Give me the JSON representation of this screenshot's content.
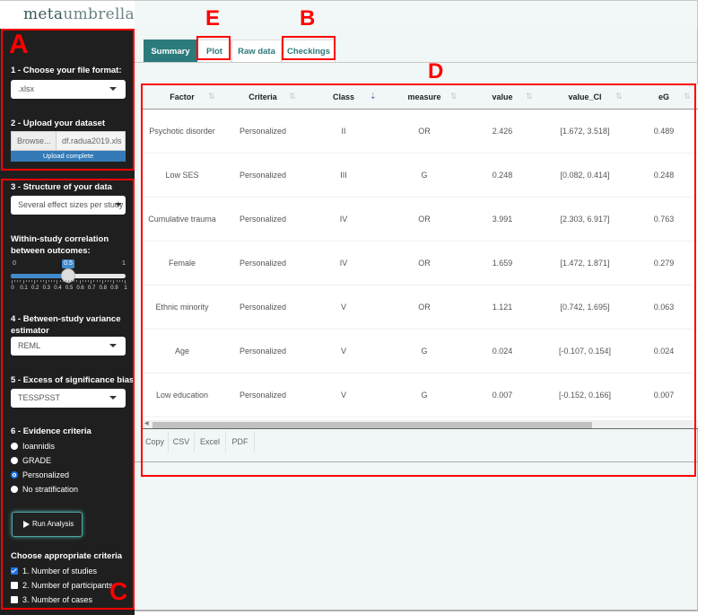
{
  "app": {
    "brand_strong": "meta",
    "brand_light": "umbrella"
  },
  "annotations": {
    "A": "A",
    "B": "B",
    "C": "C",
    "D": "D",
    "E": "E"
  },
  "sidebar": {
    "file_format_label": "1 - Choose your file format:",
    "file_format_value": ".xlsx",
    "upload_label": "2 - Upload your dataset",
    "browse_label": "Browse...",
    "file_name": "df.radua2019.xls",
    "upload_status": "Upload complete",
    "structure_label": "3 - Structure of your data",
    "structure_value": "Several effect sizes per study",
    "correlation_label_1": "Within-study correlation",
    "correlation_label_2": "between outcomes:",
    "slider": {
      "min": "0",
      "max": "1",
      "value": "0.5",
      "fraction": 0.5,
      "tick_labels": [
        "0",
        "0.1",
        "0.2",
        "0.3",
        "0.4",
        "0.5",
        "0.6",
        "0.7",
        "0.8",
        "0.9",
        "1"
      ]
    },
    "variance_label_1": "4 - Between-study variance",
    "variance_label_2": "estimator",
    "variance_value": "REML",
    "bias_label": "5 - Excess of significance bias",
    "bias_value": "TESSPSST",
    "evidence_label": "6 - Evidence criteria",
    "evidence_options": [
      {
        "label": "Ioannidis",
        "checked": false
      },
      {
        "label": "GRADE",
        "checked": false
      },
      {
        "label": "Personalized",
        "checked": true
      },
      {
        "label": "No stratification",
        "checked": false
      }
    ],
    "run_label": "Run Analysis",
    "criteria_label": "Choose appropriate criteria",
    "criteria_options": [
      {
        "label": "1. Number of studies",
        "checked": true
      },
      {
        "label": "2. Number of participants",
        "checked": false
      },
      {
        "label": "3. Number of cases",
        "checked": false
      }
    ]
  },
  "tabs": [
    {
      "label": "Summary",
      "active": true
    },
    {
      "label": "Plot",
      "active": false
    },
    {
      "label": "Raw data",
      "active": false
    },
    {
      "label": "Checkings",
      "active": false
    }
  ],
  "table": {
    "columns": [
      "Factor",
      "Criteria",
      "Class",
      "measure",
      "value",
      "value_CI",
      "eG"
    ],
    "sorted_column": "Class",
    "rows": [
      [
        "Psychotic disorder",
        "Personalized",
        "II",
        "OR",
        "2.426",
        "[1.672, 3.518]",
        "0.489"
      ],
      [
        "Low SES",
        "Personalized",
        "III",
        "G",
        "0.248",
        "[0.082, 0.414]",
        "0.248"
      ],
      [
        "Cumulative trauma",
        "Personalized",
        "IV",
        "OR",
        "3.991",
        "[2.303, 6.917]",
        "0.763"
      ],
      [
        "Female",
        "Personalized",
        "IV",
        "OR",
        "1.659",
        "[1.472, 1.871]",
        "0.279"
      ],
      [
        "Ethnic minority",
        "Personalized",
        "V",
        "OR",
        "1.121",
        "[0.742, 1.695]",
        "0.063"
      ],
      [
        "Age",
        "Personalized",
        "V",
        "G",
        "0.024",
        "[-0.107, 0.154]",
        "0.024"
      ],
      [
        "Low education",
        "Personalized",
        "V",
        "G",
        "0.007",
        "[-0.152, 0.166]",
        "0.007"
      ]
    ],
    "buttons": [
      "Copy",
      "CSV",
      "Excel",
      "PDF"
    ]
  },
  "colors": {
    "accent": "#2b7b7c",
    "sidebar_bg": "#1f1f1f",
    "annotation_red": "#ff0000",
    "slider_blue": "#428bca"
  }
}
